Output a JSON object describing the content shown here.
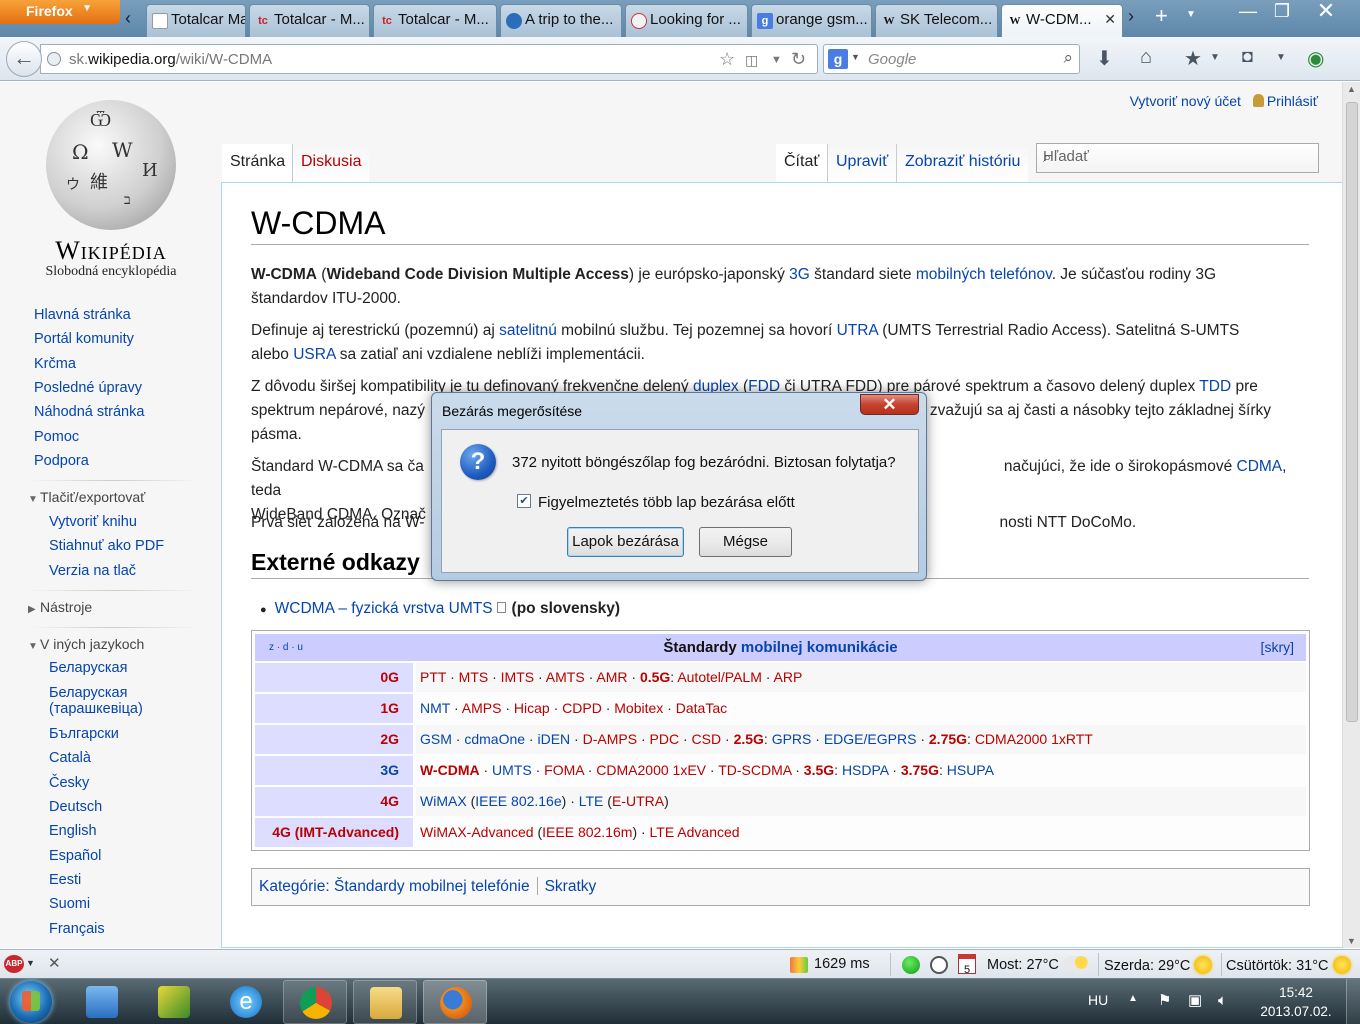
{
  "browser": {
    "menu_button": "Firefox",
    "tabs": [
      {
        "title": "Totalcar Ma...",
        "icon": "totalcar-icon"
      },
      {
        "title": "Totalcar - M...",
        "icon": "totalcar-tc-icon"
      },
      {
        "title": "Totalcar - M...",
        "icon": "totalcar-tc-icon"
      },
      {
        "title": "A trip to the...",
        "icon": "site-icon"
      },
      {
        "title": "Looking for ...",
        "icon": "site-icon"
      },
      {
        "title": "orange gsm...",
        "icon": "google-icon"
      },
      {
        "title": "SK Telecom...",
        "icon": "wikipedia-icon"
      },
      {
        "title": "W-CDM...",
        "icon": "wikipedia-icon"
      }
    ],
    "url_prefix": "sk.",
    "url_domain": "wikipedia.org",
    "url_path": "/wiki/W-CDMA",
    "search_engine_letter": "g",
    "search_placeholder": "Google"
  },
  "wiki": {
    "logo_wordmark": "Wikipédia",
    "logo_tagline": "Slobodná encyklopédia",
    "personal": {
      "create_account": "Vytvoriť nový účet",
      "login": "Prihlásiť"
    },
    "tabs": {
      "page": "Stránka",
      "talk": "Diskusia",
      "read": "Čítať",
      "edit": "Upraviť",
      "history": "Zobraziť históriu"
    },
    "search_placeholder": "Hľadať",
    "sidebar": {
      "main_links": [
        "Hlavná stránka",
        "Portál komunity",
        "Krčma",
        "Posledné úpravy",
        "Náhodná stránka",
        "Pomoc",
        "Podpora"
      ],
      "print_heading": "Tlačiť/exportovať",
      "print_links": [
        "Vytvoriť knihu",
        "Stiahnuť ako PDF",
        "Verzia na tlač"
      ],
      "tools_heading": "Nástroje",
      "languages_heading": "V iných jazykoch",
      "languages": [
        "Беларуская",
        "Беларуская",
        "(тарашкевіца)",
        "Български",
        "Català",
        "Česky",
        "Deutsch",
        "English",
        "Español",
        "Eesti",
        "Suomi",
        "Français"
      ]
    },
    "title": "W-CDMA",
    "p1": {
      "t1": "W-CDMA",
      "t2": " (",
      "t3": "Wideband Code Division Multiple Access",
      "t4": ") je európsko-japonský ",
      "l1": "3G",
      "t5": " štandard siete ",
      "l2": "mobilných telefónov",
      "t6": ". Je súčasťou rodiny 3G",
      "t7": "štandardov ITU-2000."
    },
    "p2": {
      "t1": "Definuje aj terestrickú (pozemnú) aj ",
      "l1": "satelitnú",
      "t2": " mobilnú službu. Tej pozemnej sa hovorí ",
      "l2": "UTRA",
      "t3": " (UMTS Terrestrial Radio Access). Satelitná S-UMTS",
      "t4": "alebo ",
      "l3": "USRA",
      "t5": " sa zatiaľ ani vzdialene neblíži implementácii."
    },
    "p3": {
      "t1": "Z dôvodu širšej kompatibility je tu definovaný frekvenčne delený ",
      "l1": "duplex",
      "t2": " (",
      "l2": "FDD",
      "t3": " či UTRA FDD) pre párové spektrum a časovo delený duplex ",
      "l3": "TDD",
      "t4": " pre",
      "t5": "spektrum nepárové, nazý",
      "t6": "lz, zvažujú sa aj časti a násobky tejto základnej šírky",
      "t7": "pásma."
    },
    "p4": {
      "t1": "Štandard W-CDMA sa ča",
      "t2": "načujúci, že ide o širokopásmové ",
      "l1": "CDMA",
      "t3": ", teda",
      "t4": "WideBand CDMA. Označ"
    },
    "p5": {
      "t1": "Prvá sieť založená na W-",
      "t2": "nosti NTT DoCoMo."
    },
    "ext_heading": "Externé odkazy",
    "ext_link": "WCDMA – fyzická vrstva UMTS",
    "ext_note": "(po slovensky)",
    "navbox": {
      "vde": "z · d · u",
      "title_plain": "Štandardy ",
      "title_link": "mobilnej komunikácie",
      "hide": "skry",
      "rows": [
        {
          "group": "0G",
          "items_html": "PTT · MTS · IMTS · AMTS · AMR · <b>0.5G</b>: Autotel/PALM · ARP"
        },
        {
          "group": "1G",
          "items_html": "NMT · AMPS · Hicap · CDPD · Mobitex · DataTac"
        },
        {
          "group": "2G",
          "items_html": "GSM · cdmaOne · iDEN · D-AMPS · PDC · CSD · <b>2.5G</b>: GPRS · EDGE/EGPRS · <b>2.75G</b>: CDMA2000 1xRTT"
        },
        {
          "group": "3G",
          "items_html": "<b>W-CDMA</b> · UMTS · FOMA · CDMA2000 1xEV · TD-SCDMA · <b>3.5G</b>: HSDPA · <b>3.75G</b>: HSUPA"
        },
        {
          "group": "4G",
          "items_html": "WiMAX (IEEE 802.16e) · LTE (E-UTRA)"
        },
        {
          "group": "4G (IMT-Advanced)",
          "items_html": "WiMAX-Advanced (IEEE 802.16m) · LTE Advanced"
        }
      ]
    },
    "categories_label": "Kategórie",
    "categories": [
      "Štandardy mobilnej telefónie",
      "Skratky"
    ]
  },
  "dialog": {
    "title": "Bezárás megerősítése",
    "close": "✕",
    "message": "372 nyitott böngészőlap fog bezáródni. Biztosan folytatja?",
    "checkbox_label": "Figyelmeztetés több lap bezárása előtt",
    "checkbox_checked": true,
    "ok": "Lapok bezárása",
    "cancel": "Mégse"
  },
  "statusbar": {
    "abp": "ABP",
    "load_time": "1629 ms",
    "weather_now": "Most: 27°C",
    "weather_wed": "Szerda: 29°C",
    "weather_thu": "Csütörtök: 31°C"
  },
  "taskbar": {
    "lang": "HU",
    "time": "15:42",
    "date": "2013.07.02."
  },
  "colors": {
    "link": "#0645ad",
    "redlink": "#ba0000",
    "navbox_head": "#ccccff"
  }
}
